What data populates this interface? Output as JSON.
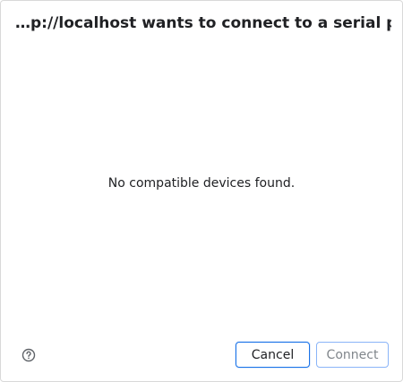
{
  "dialog": {
    "title": "…p://localhost wants to connect to a serial port",
    "message": "No compatible devices found.",
    "help_icon": "help-circle-icon",
    "buttons": {
      "cancel_label": "Cancel",
      "connect_label": "Connect"
    }
  },
  "colors": {
    "accent": "#1a73e8",
    "disabled_border": "#8ab4f8",
    "disabled_text": "#80868b",
    "text": "#202124"
  }
}
